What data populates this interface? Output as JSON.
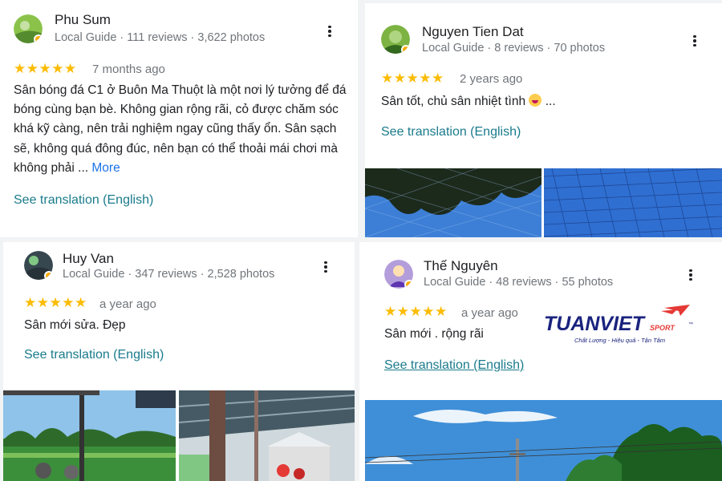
{
  "reviews": [
    {
      "name": "Phu Sum",
      "meta": "Local Guide · 111 reviews · 3,622 photos",
      "stars": "★★★★★",
      "time": "7 months ago",
      "text": "Sân bóng đá C1 ở Buôn Ma Thuột là một nơi lý tưởng để đá bóng cùng bạn bè. Không gian rộng rãi, cỏ được chăm sóc khá kỹ càng, nên trải nghiệm ngay cũng thấy ổn. Sân sạch sẽ, không quá đông đúc, nên bạn có thể thoải mái chơi mà không phải ...",
      "more": "More",
      "translate": "See translation (English)"
    },
    {
      "name": "Nguyen Tien Dat",
      "meta": "Local Guide · 8 reviews · 70 photos",
      "stars": "★★★★★",
      "time": "2 years ago",
      "text": "Sân tốt, chủ sân nhiệt tình",
      "text_suffix": " ...",
      "translate": "See translation (English)"
    },
    {
      "name": "Huy Van",
      "meta": "Local Guide · 347 reviews · 2,528 photos",
      "stars": "★★★★★",
      "time": "a year ago",
      "text": "Sân mới sửa. Đẹp",
      "translate": "See translation (English)"
    },
    {
      "name": "Thế Nguyên",
      "meta": "Local Guide · 48 reviews · 55 photos",
      "stars": "★★★★★",
      "time": "a year ago",
      "text": "Sân mới . rộng rãi",
      "translate": "See translation (English)"
    }
  ],
  "logo": {
    "brand": "TUANVIET",
    "sport": "SPORT",
    "tm": "™",
    "tagline": "Chất Lượng - Hiệu quả - Tận Tâm"
  },
  "colors": {
    "star": "#fbbc04",
    "link": "#1a7b8c",
    "more_link": "#1a73e8",
    "logo_navy": "#1a237e",
    "logo_red": "#e53935"
  },
  "icons": [
    "more-vert-icon",
    "local-guide-badge-icon",
    "star-icon",
    "laughing-emoji-icon"
  ]
}
